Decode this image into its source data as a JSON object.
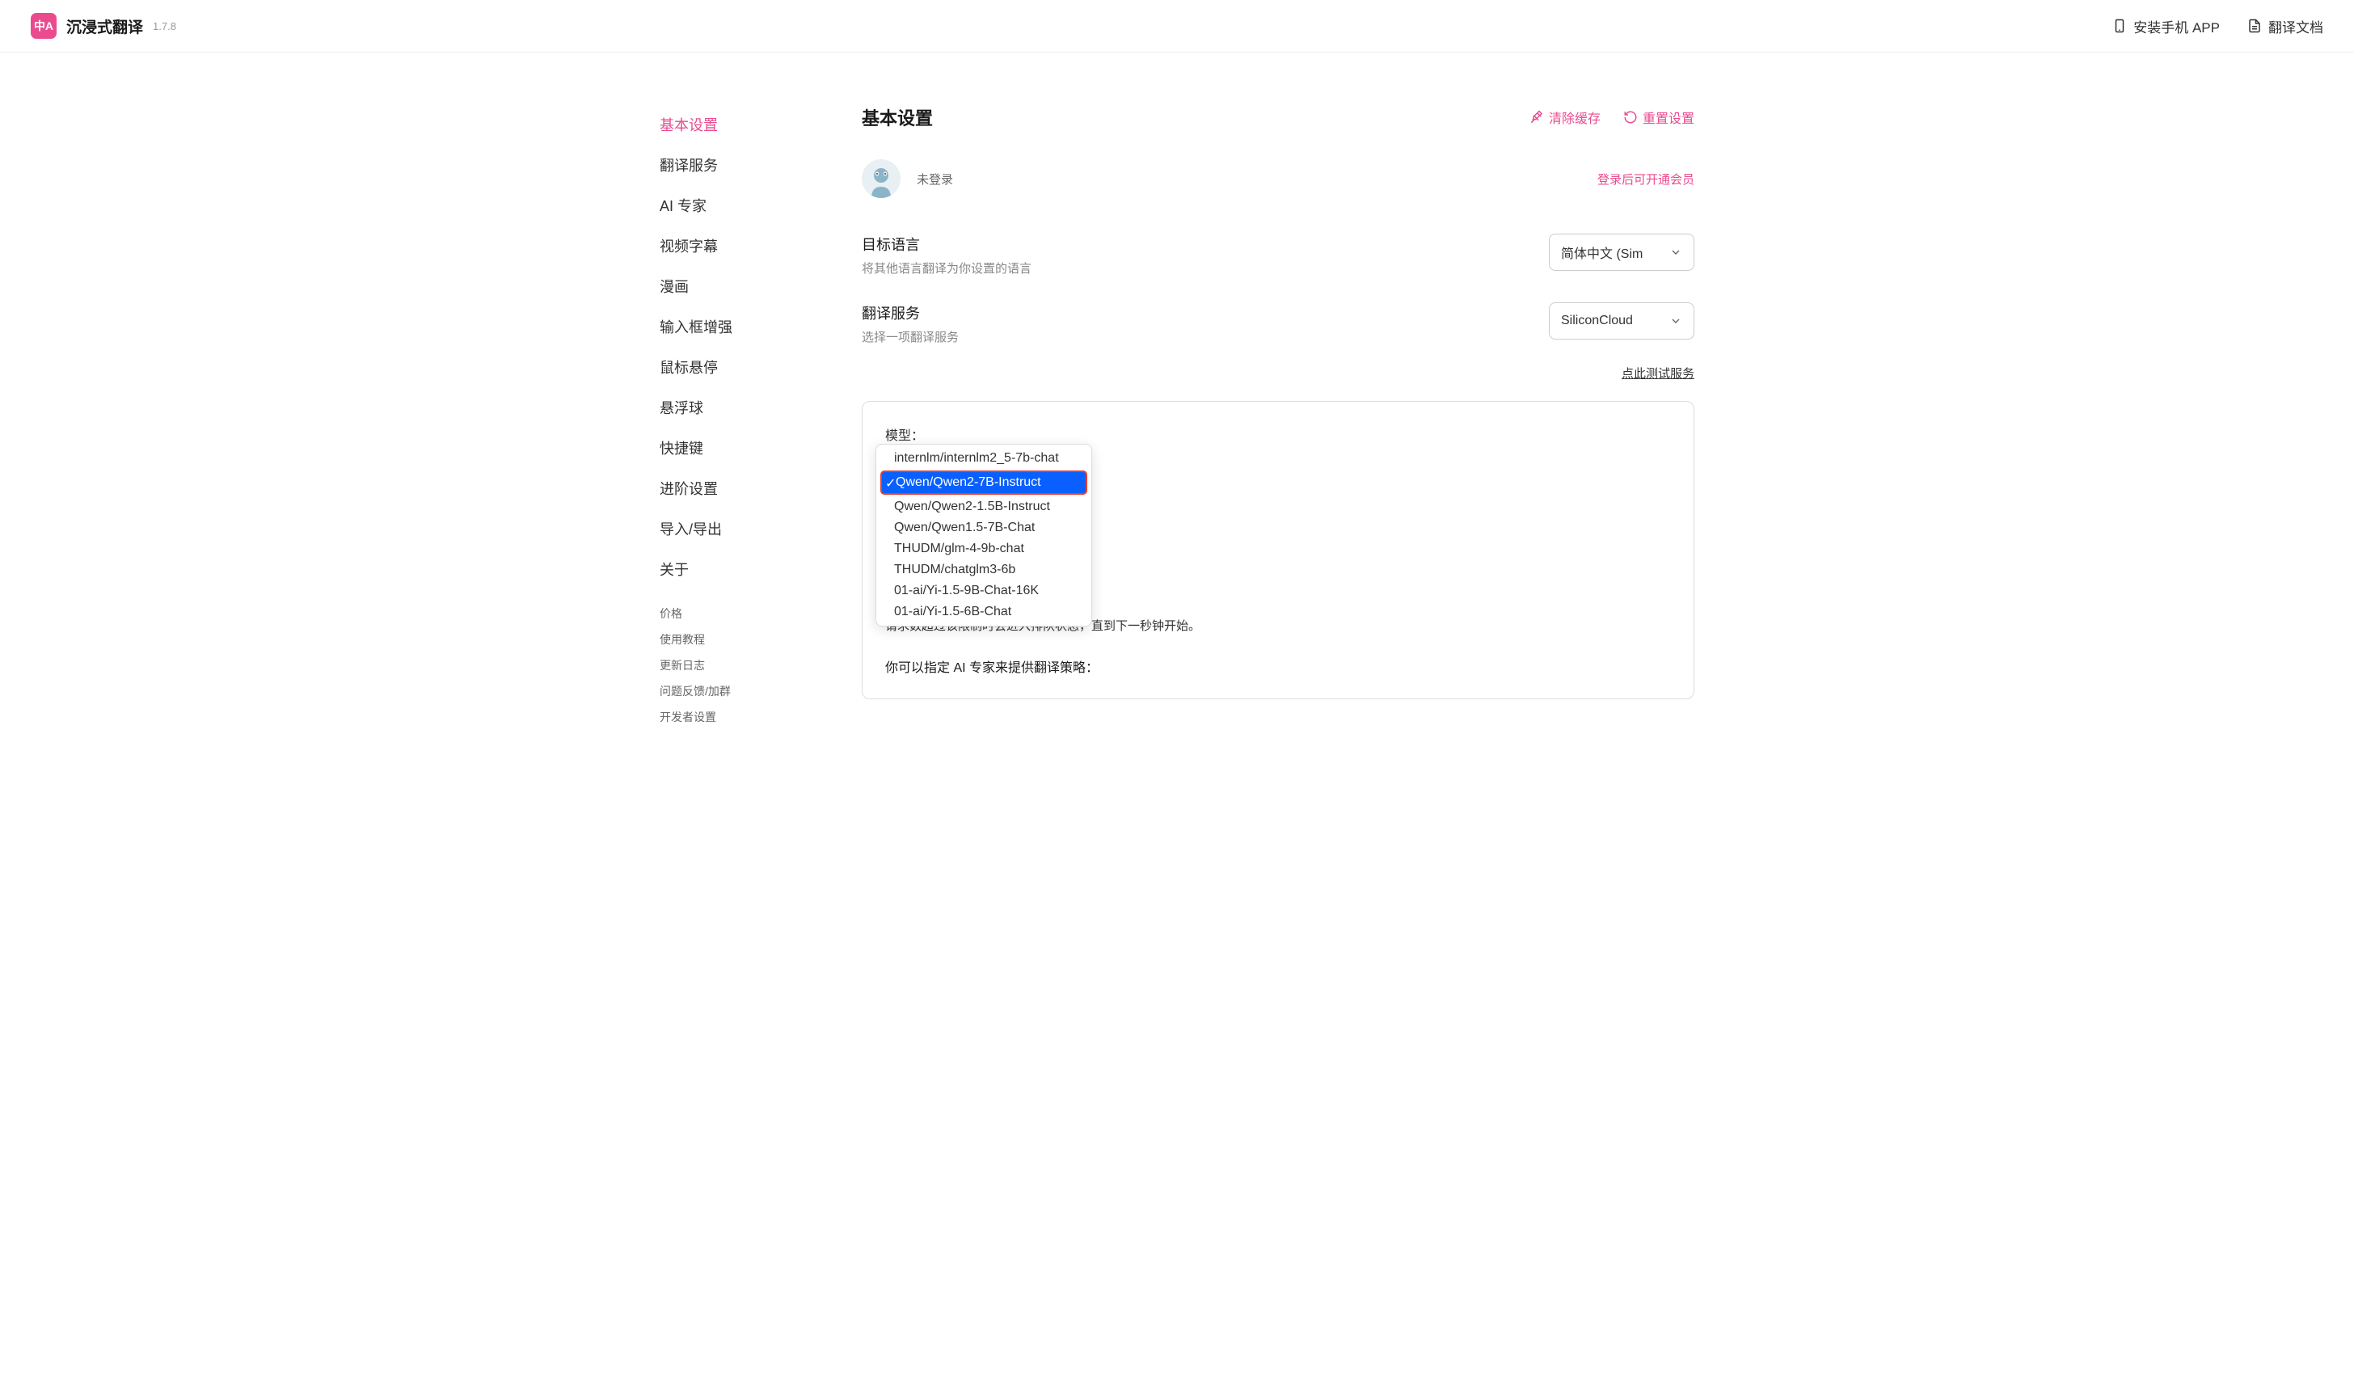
{
  "header": {
    "app_name": "沉浸式翻译",
    "version": "1.7.8",
    "install_app": "安装手机 APP",
    "translate_doc": "翻译文档"
  },
  "sidebar": {
    "items": [
      {
        "label": "基本设置",
        "active": true
      },
      {
        "label": "翻译服务",
        "active": false
      },
      {
        "label": "AI 专家",
        "active": false
      },
      {
        "label": "视频字幕",
        "active": false
      },
      {
        "label": "漫画",
        "active": false
      },
      {
        "label": "输入框增强",
        "active": false
      },
      {
        "label": "鼠标悬停",
        "active": false
      },
      {
        "label": "悬浮球",
        "active": false
      },
      {
        "label": "快捷键",
        "active": false
      },
      {
        "label": "进阶设置",
        "active": false
      },
      {
        "label": "导入/导出",
        "active": false
      },
      {
        "label": "关于",
        "active": false
      }
    ],
    "small_items": [
      {
        "label": "价格"
      },
      {
        "label": "使用教程"
      },
      {
        "label": "更新日志"
      },
      {
        "label": "问题反馈/加群"
      },
      {
        "label": "开发者设置"
      }
    ]
  },
  "content": {
    "title": "基本设置",
    "clear_cache": "清除缓存",
    "reset_settings": "重置设置",
    "user_status": "未登录",
    "login_hint": "登录后可开通会员",
    "target_lang": {
      "label": "目标语言",
      "desc": "将其他语言翻译为你设置的语言",
      "value": "简体中文 (Sim"
    },
    "service": {
      "label": "翻译服务",
      "desc": "选择一项翻译服务",
      "value": "SiliconCloud"
    },
    "test_link": "点此测试服务",
    "model_label": "模型：",
    "dropdown_items": [
      {
        "label": "internlm/internlm2_5-7b-chat",
        "selected": false
      },
      {
        "label": "Qwen/Qwen2-7B-Instruct",
        "selected": true
      },
      {
        "label": "Qwen/Qwen2-1.5B-Instruct",
        "selected": false
      },
      {
        "label": "Qwen/Qwen1.5-7B-Chat",
        "selected": false
      },
      {
        "label": "THUDM/glm-4-9b-chat",
        "selected": false
      },
      {
        "label": "THUDM/chatglm3-6b",
        "selected": false
      },
      {
        "label": "01-ai/Yi-1.5-9B-Chat-16K",
        "selected": false
      },
      {
        "label": "01-ai/Yi-1.5-6B-Chat",
        "selected": false
      }
    ],
    "throttle_hint": "请求数超过该限制时会进入排队状态，直到下一秒钟开始。",
    "expert_hint": "你可以指定 AI 专家来提供翻译策略："
  }
}
